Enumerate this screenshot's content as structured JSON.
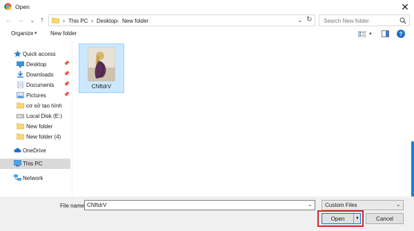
{
  "window": {
    "title": "Open",
    "close_glyph": "✕"
  },
  "nav": {
    "back_icon": "back-arrow-icon",
    "forward_icon": "forward-arrow-icon",
    "up_icon": "up-arrow-icon"
  },
  "address": {
    "crumbs": [
      "This PC",
      "Desktop",
      "New folder"
    ],
    "separator": "›"
  },
  "search": {
    "placeholder": "Search New folder"
  },
  "toolbar": {
    "organize_label": "Organize",
    "new_folder_label": "New folder",
    "help_label": "?"
  },
  "sidebar": {
    "items": [
      {
        "label": "Quick access",
        "icon": "star-icon"
      },
      {
        "label": "Desktop",
        "icon": "desktop-icon",
        "pinned": true
      },
      {
        "label": "Downloads",
        "icon": "download-icon",
        "pinned": true
      },
      {
        "label": "Documents",
        "icon": "documents-icon",
        "pinned": true
      },
      {
        "label": "Pictures",
        "icon": "pictures-icon",
        "pinned": true
      },
      {
        "label": "cơ sở tạo hình",
        "icon": "folder-icon"
      },
      {
        "label": "Local Disk (E:)",
        "icon": "drive-icon"
      },
      {
        "label": "New folder",
        "icon": "folder-icon"
      },
      {
        "label": "New folder (4)",
        "icon": "folder-icon"
      },
      {
        "label": "OneDrive",
        "icon": "cloud-icon"
      },
      {
        "label": "This PC",
        "icon": "computer-icon",
        "selected": true
      },
      {
        "label": "Network",
        "icon": "network-icon"
      }
    ]
  },
  "files": [
    {
      "name": "CNftdrV",
      "selected": true
    }
  ],
  "bottom": {
    "file_name_label": "File name:",
    "file_name_value": "CNftdrV",
    "filter_value": "Custom Files",
    "open_label": "Open",
    "cancel_label": "Cancel"
  },
  "colors": {
    "accent": "#0078d7",
    "selection": "#cce8ff",
    "highlight_box": "#d6202a",
    "folder": "#f8d775"
  }
}
